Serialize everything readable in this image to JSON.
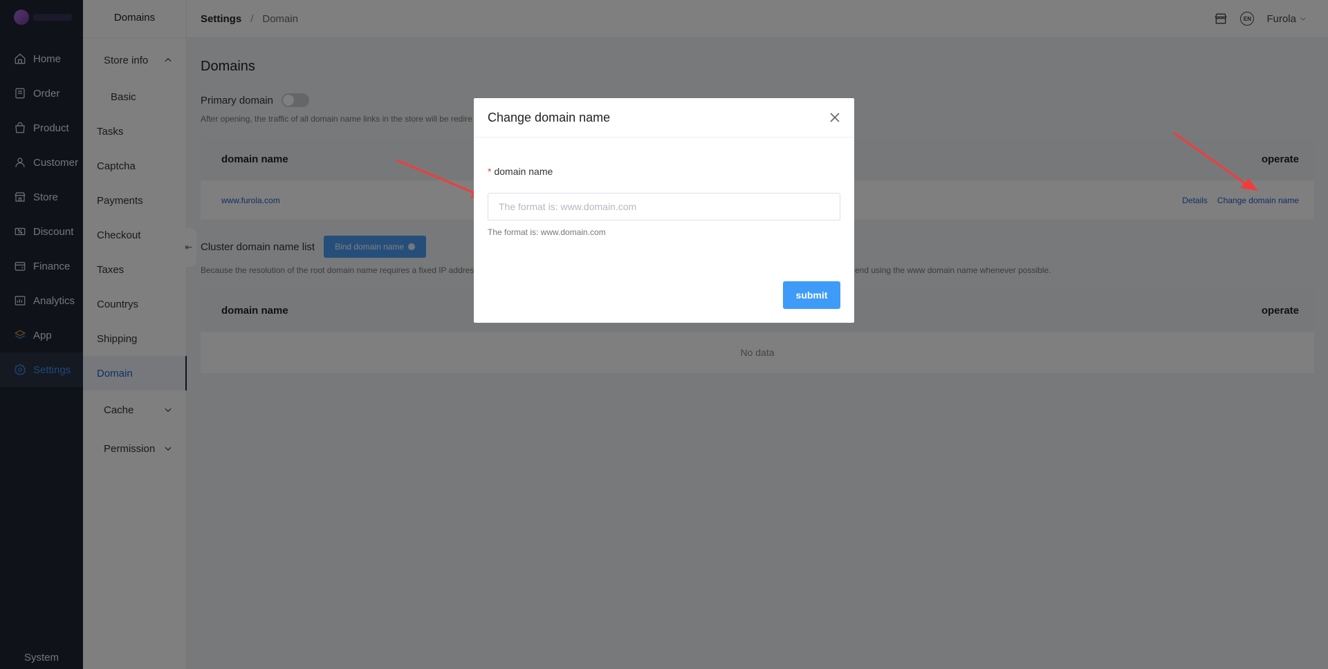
{
  "mainnav": {
    "items": [
      {
        "label": "Home",
        "icon": "home-icon"
      },
      {
        "label": "Order",
        "icon": "order-icon"
      },
      {
        "label": "Product",
        "icon": "product-icon"
      },
      {
        "label": "Customer",
        "icon": "customer-icon"
      },
      {
        "label": "Store",
        "icon": "store-icon"
      },
      {
        "label": "Discount",
        "icon": "discount-icon"
      },
      {
        "label": "Finance",
        "icon": "finance-icon"
      },
      {
        "label": "Analytics",
        "icon": "analytics-icon"
      },
      {
        "label": "App",
        "icon": "app-icon"
      },
      {
        "label": "Settings",
        "icon": "settings-icon"
      }
    ],
    "system_label": "System"
  },
  "subnav": {
    "title": "Domains",
    "store_info": "Store info",
    "basic": "Basic",
    "tasks": "Tasks",
    "captcha": "Captcha",
    "payments": "Payments",
    "checkout": "Checkout",
    "taxes": "Taxes",
    "countrys": "Countrys",
    "shipping": "Shipping",
    "domain": "Domain",
    "cache": "Cache",
    "permission": "Permission"
  },
  "topbar": {
    "breadcrumb_root": "Settings",
    "breadcrumb_sep": "/",
    "breadcrumb_current": "Domain",
    "lang_badge": "EN",
    "user": "Furola"
  },
  "main": {
    "title": "Domains",
    "primary_domain_label": "Primary domain",
    "primary_note": "After opening, the traffic of all domain name links in the store will be redire",
    "table1": {
      "col_domain": "domain name",
      "col_operate": "operate",
      "rows": [
        {
          "domain": "www.furola.com",
          "details": "Details",
          "change": "Change domain name"
        }
      ]
    },
    "cluster_label": "Cluster domain name list",
    "bind_button": "Bind domain name",
    "cluster_note_left": "Because the resolution of the root domain name requires a fixed IP address",
    "cluster_note_right": "end using the www domain name whenever possible.",
    "table2": {
      "col_domain": "domain name",
      "col_operate": "operate",
      "empty": "No data"
    }
  },
  "modal": {
    "title": "Change domain name",
    "required_mark": "*",
    "field_label": "domain name",
    "placeholder": "The format is: www.domain.com",
    "hint": "The format is: www.domain.com",
    "submit": "submit"
  },
  "colors": {
    "nav_bg": "#1f2633",
    "accent": "#3e8ef7",
    "link": "#1f5fc9",
    "annotation_arrow": "#f23c3c"
  }
}
